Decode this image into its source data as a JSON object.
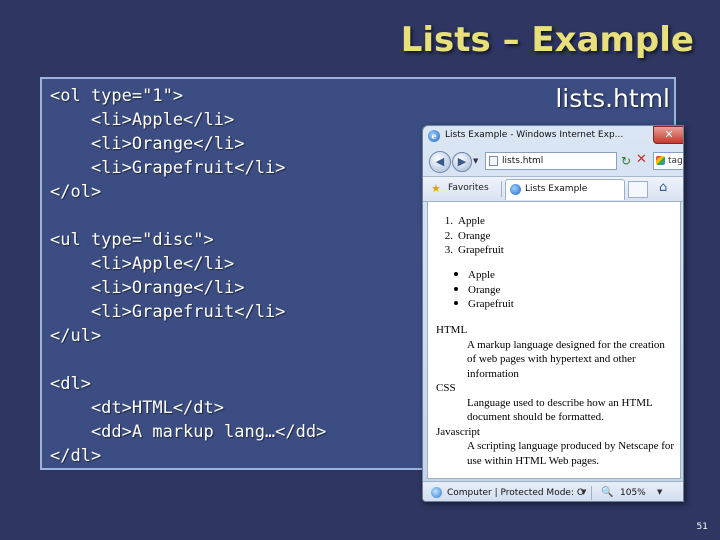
{
  "slide": {
    "title": "Lists – Example",
    "file_label": "lists.html",
    "page_number": "51"
  },
  "code_lines": [
    "<ol type=\"1\">",
    "    <li>Apple</li>",
    "    <li>Orange</li>",
    "    <li>Grapefruit</li>",
    "</ol>",
    "",
    "<ul type=\"disc\">",
    "    <li>Apple</li>",
    "    <li>Orange</li>",
    "    <li>Grapefruit</li>",
    "</ul>",
    "",
    "<dl>",
    "    <dt>HTML</dt>",
    "    <dd>A markup lang…</dd>",
    "</dl>"
  ],
  "browser": {
    "window_title": "Lists Example - Windows Internet Exp...",
    "address": "lists.html",
    "search_text": "tag i",
    "favorites_label": "Favorites",
    "tab_label": "Lists Example",
    "status_text": "Computer | Protected Mode: O",
    "zoom": "105%",
    "content": {
      "ordered": [
        {
          "num": "1.",
          "text": "Apple"
        },
        {
          "num": "2.",
          "text": "Orange"
        },
        {
          "num": "3.",
          "text": "Grapefruit"
        }
      ],
      "bullets": [
        "Apple",
        "Orange",
        "Grapefruit"
      ],
      "definitions": [
        {
          "term": "HTML",
          "desc": "A markup language designed for the creation of web pages with hypertext and other information"
        },
        {
          "term": "CSS",
          "desc": "Language used to describe how an HTML document should be formatted."
        },
        {
          "term": "Javascript",
          "desc": "A scripting language produced by Netscape for use within HTML Web pages."
        }
      ]
    }
  }
}
